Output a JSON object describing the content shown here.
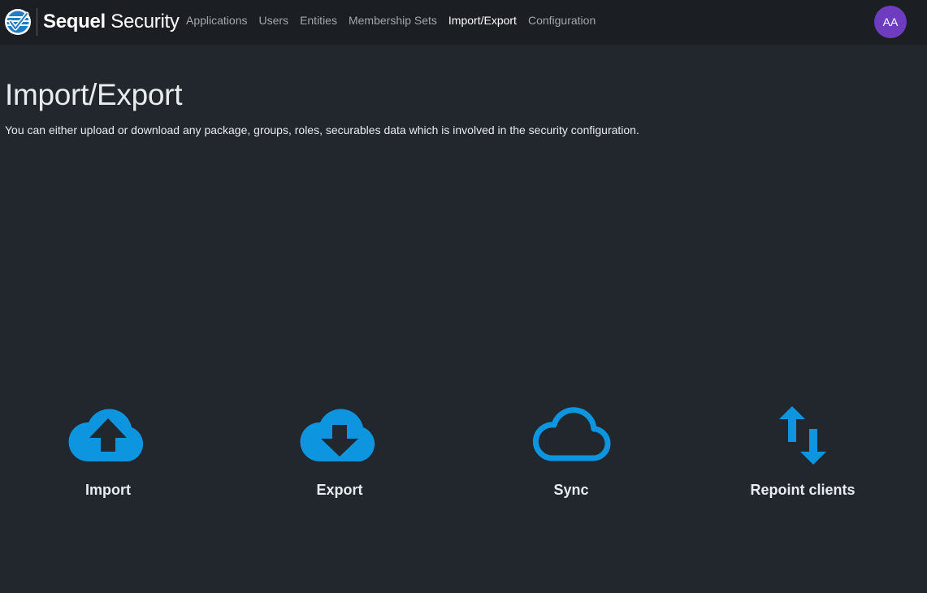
{
  "header": {
    "brand_bold": "Sequel",
    "brand_light": " Security",
    "logo_icon": "checkmark-globe-icon",
    "nav": [
      {
        "label": "Applications",
        "active": false
      },
      {
        "label": "Users",
        "active": false
      },
      {
        "label": "Entities",
        "active": false
      },
      {
        "label": "Membership Sets",
        "active": false
      },
      {
        "label": "Import/Export",
        "active": true
      },
      {
        "label": "Configuration",
        "active": false
      }
    ],
    "avatar_initials": "AA"
  },
  "main": {
    "title": "Import/Export",
    "description": "You can either upload or download any package, groups, roles, securables data which is involved in the security configuration.",
    "actions": [
      {
        "label": "Import",
        "icon": "cloud-upload-icon"
      },
      {
        "label": "Export",
        "icon": "cloud-download-icon"
      },
      {
        "label": "Sync",
        "icon": "cloud-outline-icon"
      },
      {
        "label": "Repoint clients",
        "icon": "swap-arrows-icon"
      }
    ]
  },
  "colors": {
    "background": "#22262d",
    "topbar": "#1b1e23",
    "accent_blue": "#0d95e0",
    "avatar": "#6e3dbf",
    "nav_text": "#a3a8ae",
    "nav_active_text": "#ffffff"
  }
}
